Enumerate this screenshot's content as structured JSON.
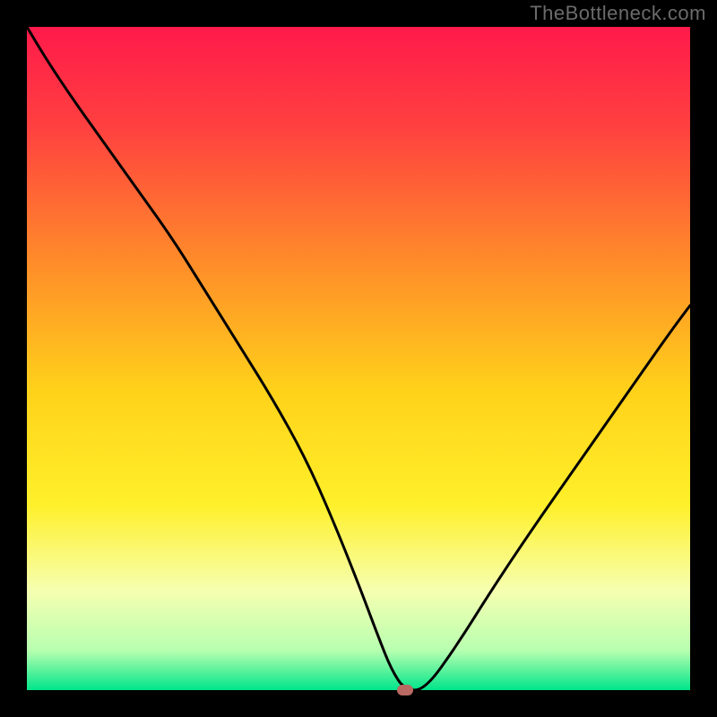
{
  "watermark": {
    "text": "TheBottleneck.com"
  },
  "colors": {
    "bg": "#000000",
    "watermark": "#6b6b6b",
    "curve": "#000000",
    "marker": "#b96a63",
    "gradient_stops": [
      {
        "offset": 0.0,
        "color": "#ff1a4b"
      },
      {
        "offset": 0.15,
        "color": "#ff4040"
      },
      {
        "offset": 0.35,
        "color": "#ff8a2a"
      },
      {
        "offset": 0.55,
        "color": "#ffd21a"
      },
      {
        "offset": 0.72,
        "color": "#fff02a"
      },
      {
        "offset": 0.85,
        "color": "#f6ffb0"
      },
      {
        "offset": 0.94,
        "color": "#b8ffb0"
      },
      {
        "offset": 1.0,
        "color": "#00e58a"
      }
    ]
  },
  "chart_data": {
    "type": "line",
    "title": "",
    "xlabel": "",
    "ylabel": "",
    "xlim": [
      0,
      100
    ],
    "ylim": [
      0,
      100
    ],
    "grid": false,
    "legend": false,
    "series": [
      {
        "name": "bottleneck-curve",
        "x": [
          0,
          3,
          7,
          12,
          17,
          22,
          27,
          32,
          37,
          42,
          46,
          50,
          53,
          55,
          57,
          60,
          65,
          70,
          76,
          83,
          90,
          97,
          100
        ],
        "values": [
          100,
          95,
          89,
          82,
          75,
          68,
          60,
          52,
          44,
          35,
          26,
          16,
          8,
          3,
          0,
          0,
          7,
          15,
          24,
          34,
          44,
          54,
          58
        ]
      }
    ],
    "marker": {
      "x": 57,
      "y": 0,
      "name": "minimum-point",
      "color": "#b96a63"
    }
  }
}
